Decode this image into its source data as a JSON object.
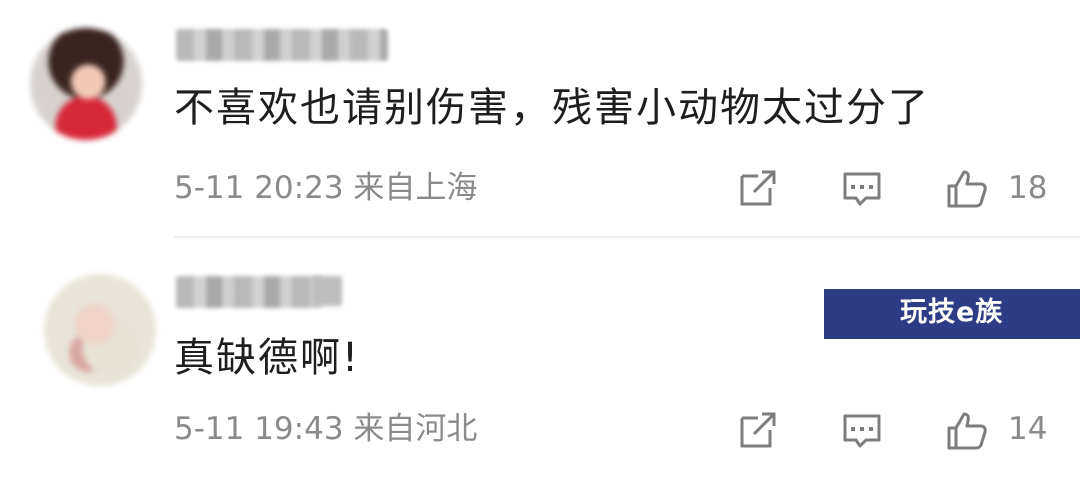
{
  "comments": [
    {
      "text": "不喜欢也请别伤害，残害小动物太过分了",
      "meta": "5-11 20:23 来自上海",
      "likes": "18"
    },
    {
      "text": "真缺德啊!",
      "meta": "5-11 19:43 来自河北",
      "likes": "14"
    }
  ],
  "watermark": {
    "text": "玩技e族"
  },
  "icons": {
    "share": "share-icon",
    "reply": "reply-icon",
    "like": "like-icon"
  },
  "colors": {
    "meta_text": "#8a8a8a",
    "watermark_bg": "#2c3d85"
  }
}
